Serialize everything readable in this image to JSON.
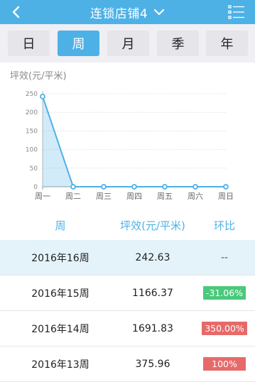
{
  "header": {
    "title": "连锁店铺4",
    "back_icon": "chevron-left-icon",
    "menu_icon": "list-menu-icon"
  },
  "tabs": [
    {
      "label": "日",
      "active": false
    },
    {
      "label": "周",
      "active": true
    },
    {
      "label": "月",
      "active": false
    },
    {
      "label": "季",
      "active": false
    },
    {
      "label": "年",
      "active": false
    }
  ],
  "chart_data": {
    "type": "area",
    "ylabel": "坪效(元/平米)",
    "categories": [
      "周一",
      "周二",
      "周三",
      "周四",
      "周五",
      "周六",
      "周日"
    ],
    "values": [
      242.63,
      0,
      0,
      0,
      0,
      0,
      0
    ],
    "ylim": [
      0,
      250
    ],
    "yticks": [
      0,
      50,
      100,
      150,
      200,
      250
    ],
    "grid": true,
    "color": "#4db1e6"
  },
  "table": {
    "headers": [
      "周",
      "坪效(元/平米)",
      "环比"
    ],
    "rows": [
      {
        "week": "2016年16周",
        "value": "242.63",
        "change": "--",
        "status": "none"
      },
      {
        "week": "2016年15周",
        "value": "1166.37",
        "change": "-31.06%",
        "status": "down"
      },
      {
        "week": "2016年14周",
        "value": "1691.83",
        "change": "350.00%",
        "status": "up"
      },
      {
        "week": "2016年13周",
        "value": "375.96",
        "change": "100%",
        "status": "up"
      }
    ]
  },
  "colors": {
    "accent": "#4db1e6",
    "positive": "#e66a6a",
    "negative": "#49c97a"
  }
}
